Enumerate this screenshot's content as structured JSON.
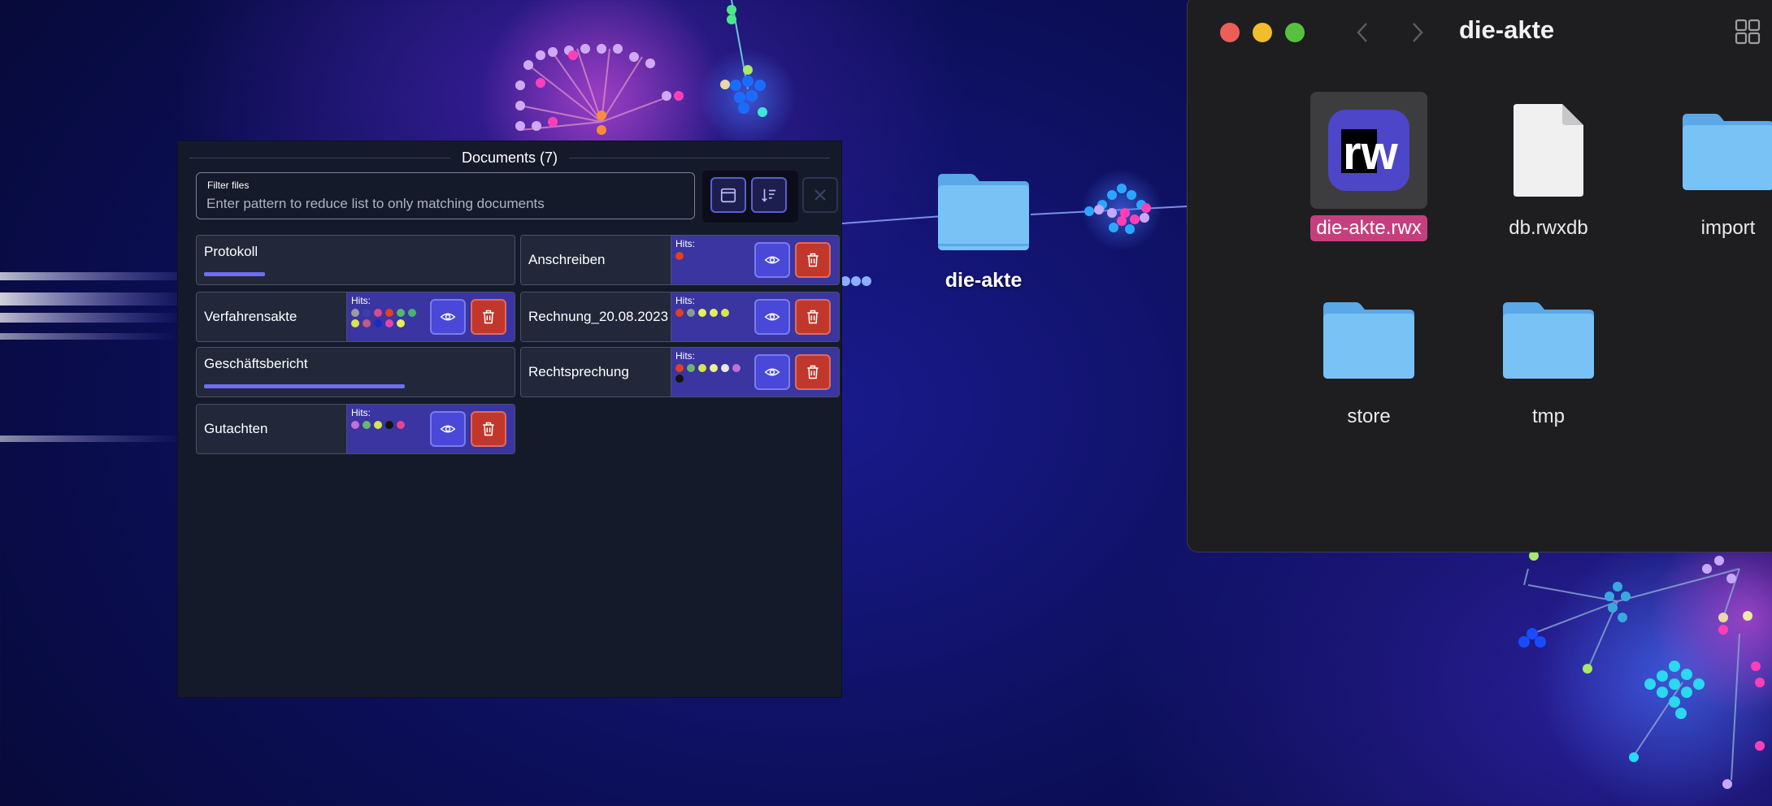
{
  "desktop": {
    "folder_label": "die-akte"
  },
  "documents_panel": {
    "title": "Documents (7)",
    "filter": {
      "label": "Filter files",
      "placeholder": "Enter pattern to reduce list to only matching documents",
      "value": ""
    },
    "hits_label": "Hits:",
    "documents": [
      {
        "name": "Protokoll",
        "state": "progress",
        "progress": 0.2
      },
      {
        "name": "Anschreiben",
        "state": "hits",
        "hits": [
          "#e2401f"
        ]
      },
      {
        "name": "Verfahrensakte",
        "state": "hits",
        "hits": [
          "#9b9b9b",
          "#3a3fb0",
          "#d94a8c",
          "#e2401f",
          "#54b86a",
          "#49b36f",
          "#d6e64b",
          "#c05a8c",
          "#1a2ac8",
          "#e046b4",
          "#e4f05a"
        ]
      },
      {
        "name": "Rechnung_20.08.2023",
        "state": "hits",
        "hits": [
          "#e2401f",
          "#8a9a9a",
          "#e4f05a",
          "#e4f05a",
          "#d6e64b"
        ]
      },
      {
        "name": "Geschäftsbericht",
        "state": "progress",
        "progress": 0.66
      },
      {
        "name": "Rechtsprechung",
        "state": "hits",
        "hits": [
          "#e2401f",
          "#6db46a",
          "#d6e64b",
          "#f0f08a",
          "#e8e8e8",
          "#c070d8",
          "#141414"
        ]
      },
      {
        "name": "Gutachten",
        "state": "hits",
        "hits": [
          "#c070d8",
          "#68b86a",
          "#d6e64b",
          "#141414",
          "#e04694"
        ]
      }
    ],
    "colors": {
      "eye_button": "#4a48d8",
      "delete_button": "#c2372c",
      "progress_bar": "#6d6ff5",
      "hits_background": "#3a35a0"
    }
  },
  "finder": {
    "title": "die-akte",
    "items": [
      {
        "label": "die-akte.rwx",
        "kind": "app-icon",
        "selected": true
      },
      {
        "label": "db.rwxdb",
        "kind": "document"
      },
      {
        "label": "import",
        "kind": "folder"
      },
      {
        "label": "store",
        "kind": "folder"
      },
      {
        "label": "tmp",
        "kind": "folder"
      }
    ],
    "app_logo_text": "rw"
  }
}
